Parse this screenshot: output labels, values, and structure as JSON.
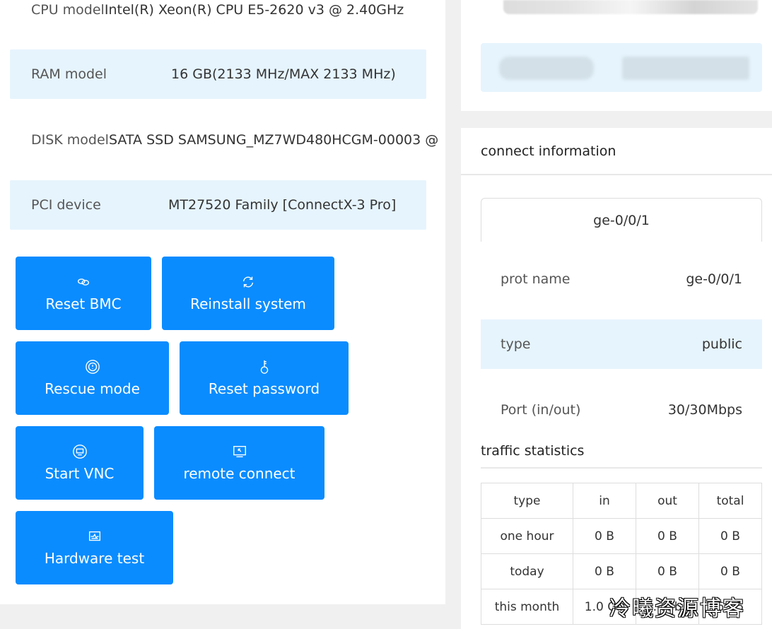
{
  "specs": [
    {
      "label": "CPU model",
      "value": "Intel(R) Xeon(R) CPU E5-2620 v3 @ 2.40GHz"
    },
    {
      "label": "RAM model",
      "value": "16 GB(2133 MHz/MAX 2133 MHz)"
    },
    {
      "label": "DISK model",
      "value": "SATA SSD SAMSUNG_MZ7WD480HCGM-00003 @"
    },
    {
      "label": "PCI device",
      "value": "MT27520 Family [ConnectX-3 Pro]"
    }
  ],
  "actions": [
    {
      "label": "Reset BMC",
      "icon": "link-icon"
    },
    {
      "label": "Reinstall system",
      "icon": "refresh-icon"
    },
    {
      "label": "Rescue mode",
      "icon": "lifebuoy-icon"
    },
    {
      "label": "Reset password",
      "icon": "key-icon"
    },
    {
      "label": "Start VNC",
      "icon": "vnc-icon"
    },
    {
      "label": "remote connect",
      "icon": "remote-screen-icon"
    },
    {
      "label": "Hardware test",
      "icon": "monitor-chart-icon"
    }
  ],
  "connect": {
    "title": "connect information",
    "tab": "ge-0/0/1",
    "rows": [
      {
        "label": "prot name",
        "value": "ge-0/0/1"
      },
      {
        "label": "type",
        "value": "public"
      },
      {
        "label": "Port (in/out)",
        "value": "30/30Mbps"
      }
    ],
    "traffic_title": "traffic statistics",
    "table": {
      "headers": [
        "type",
        "in",
        "out",
        "total"
      ],
      "rows": [
        [
          "one hour",
          "0 B",
          "0 B",
          "0 B"
        ],
        [
          "today",
          "0 B",
          "0 B",
          "0 B"
        ],
        [
          "this month",
          "1.0 Gb",
          "…Gb",
          "6…5"
        ]
      ]
    }
  },
  "watermark": "冷曦资源博客",
  "colors": {
    "primary": "#0a8cff",
    "highlight": "#e6f4fd"
  }
}
